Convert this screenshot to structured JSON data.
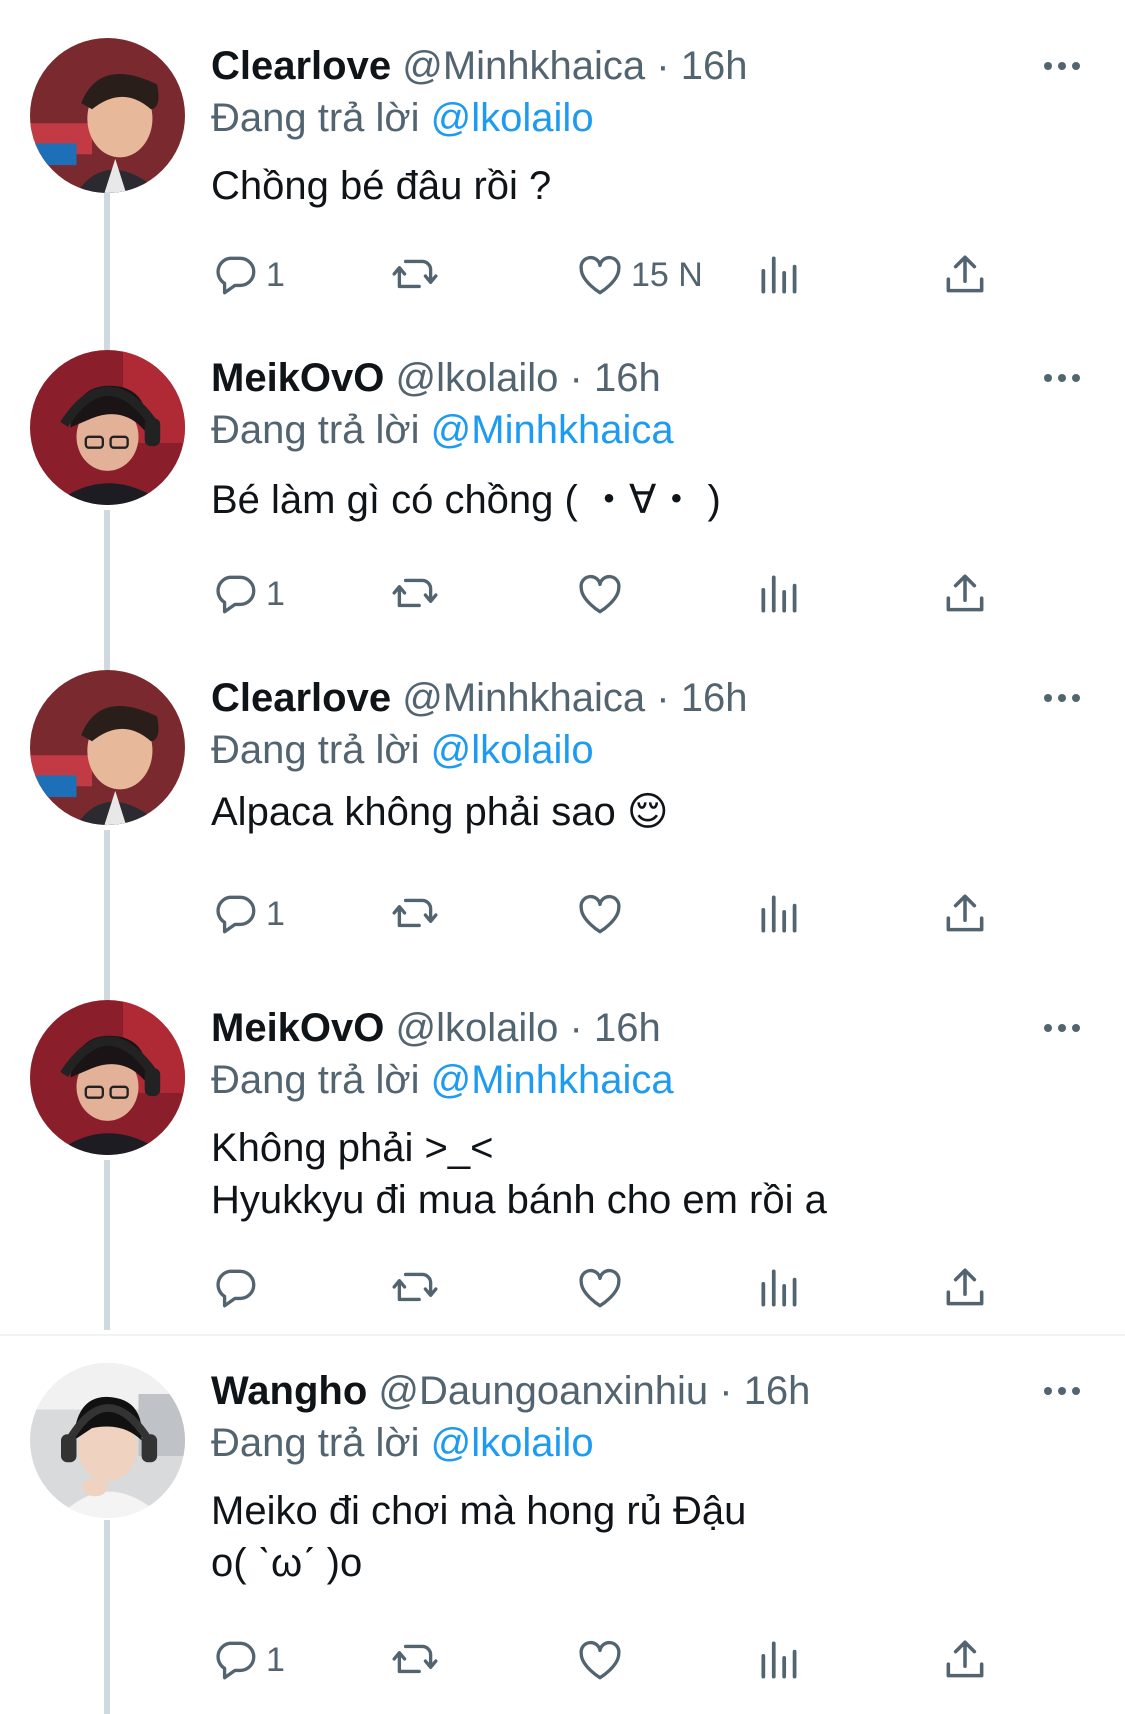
{
  "tweets": [
    {
      "name": "Clearlove",
      "handle": "@Minhkhaica",
      "dot": "·",
      "time": "16h",
      "reply_prefix": "Đang trả lời",
      "reply_mention": "@lkolailo",
      "lines": [
        "Chồng bé đâu rồi ?"
      ],
      "reply_count": "1",
      "retweet_count": "",
      "like_count": "15 N",
      "avatar": "clearlove"
    },
    {
      "name": "MeikOvO",
      "handle": "@lkolailo",
      "dot": "·",
      "time": "16h",
      "reply_prefix": "Đang trả lời",
      "reply_mention": "@Minhkhaica",
      "lines": [
        "Bé làm gì có chồng ( ・∀・ )"
      ],
      "reply_count": "1",
      "retweet_count": "",
      "like_count": "",
      "avatar": "meiko"
    },
    {
      "name": "Clearlove",
      "handle": "@Minhkhaica",
      "dot": "·",
      "time": "16h",
      "reply_prefix": "Đang trả lời",
      "reply_mention": "@lkolailo",
      "lines": [
        "Alpaca không phải sao 😌"
      ],
      "reply_count": "1",
      "retweet_count": "",
      "like_count": "",
      "avatar": "clearlove"
    },
    {
      "name": "MeikOvO",
      "handle": "@lkolailo",
      "dot": "·",
      "time": "16h",
      "reply_prefix": "Đang trả lời",
      "reply_mention": "@Minhkhaica",
      "lines": [
        "Không phải >_<",
        "Hyukkyu đi mua bánh cho em rồi a"
      ],
      "reply_count": "",
      "retweet_count": "",
      "like_count": "",
      "avatar": "meiko"
    },
    {
      "name": "Wangho",
      "handle": "@Daungoanxinhiu",
      "dot": "·",
      "time": "16h",
      "reply_prefix": "Đang trả lời",
      "reply_mention": "@lkolailo",
      "lines": [
        "Meiko đi chơi mà hong rủ Đậu",
        "o( ˋωˊ )o"
      ],
      "reply_count": "1",
      "retweet_count": "",
      "like_count": "",
      "avatar": "wangho"
    }
  ],
  "icons": {
    "reply": "reply-icon",
    "retweet": "retweet-icon",
    "like": "like-icon",
    "views": "views-icon",
    "share": "share-icon",
    "more": "more-icon"
  },
  "colors": {
    "link": "#1d9bf0",
    "muted": "#536471",
    "text": "#0f1419",
    "thread_line": "#cfd9de"
  }
}
